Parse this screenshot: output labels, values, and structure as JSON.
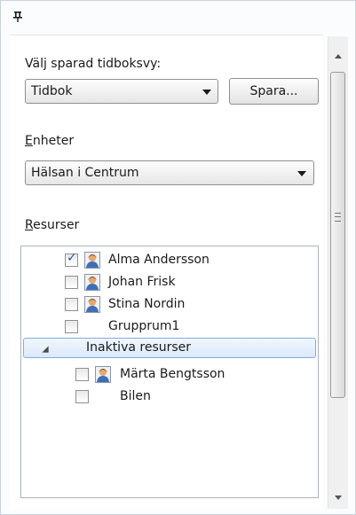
{
  "saved_view": {
    "label": "Välj sparad tidboksvy:",
    "selected": "Tidbok",
    "save_button": "Spara..."
  },
  "units": {
    "label": "Enheter",
    "selected": "Hälsan i Centrum"
  },
  "resources": {
    "label": "Resurser",
    "items": [
      {
        "name": "Alma Andersson",
        "checked": true,
        "icon": "person-icon"
      },
      {
        "name": "Johan Frisk",
        "checked": false,
        "icon": "person-icon"
      },
      {
        "name": "Stina Nordin",
        "checked": false,
        "icon": "person-icon"
      },
      {
        "name": "Grupprum1",
        "checked": false,
        "icon": ""
      }
    ],
    "inactive_group": {
      "label": "Inaktiva resurser",
      "expanded": true,
      "items": [
        {
          "name": "Märta Bengtsson",
          "checked": false,
          "icon": "person-icon"
        },
        {
          "name": "Bilen",
          "checked": false,
          "icon": ""
        }
      ]
    }
  },
  "colors": {
    "selection_border": "#84acdd",
    "selection_fill": "#dbe9fb",
    "checkmark": "#2a56a8"
  }
}
